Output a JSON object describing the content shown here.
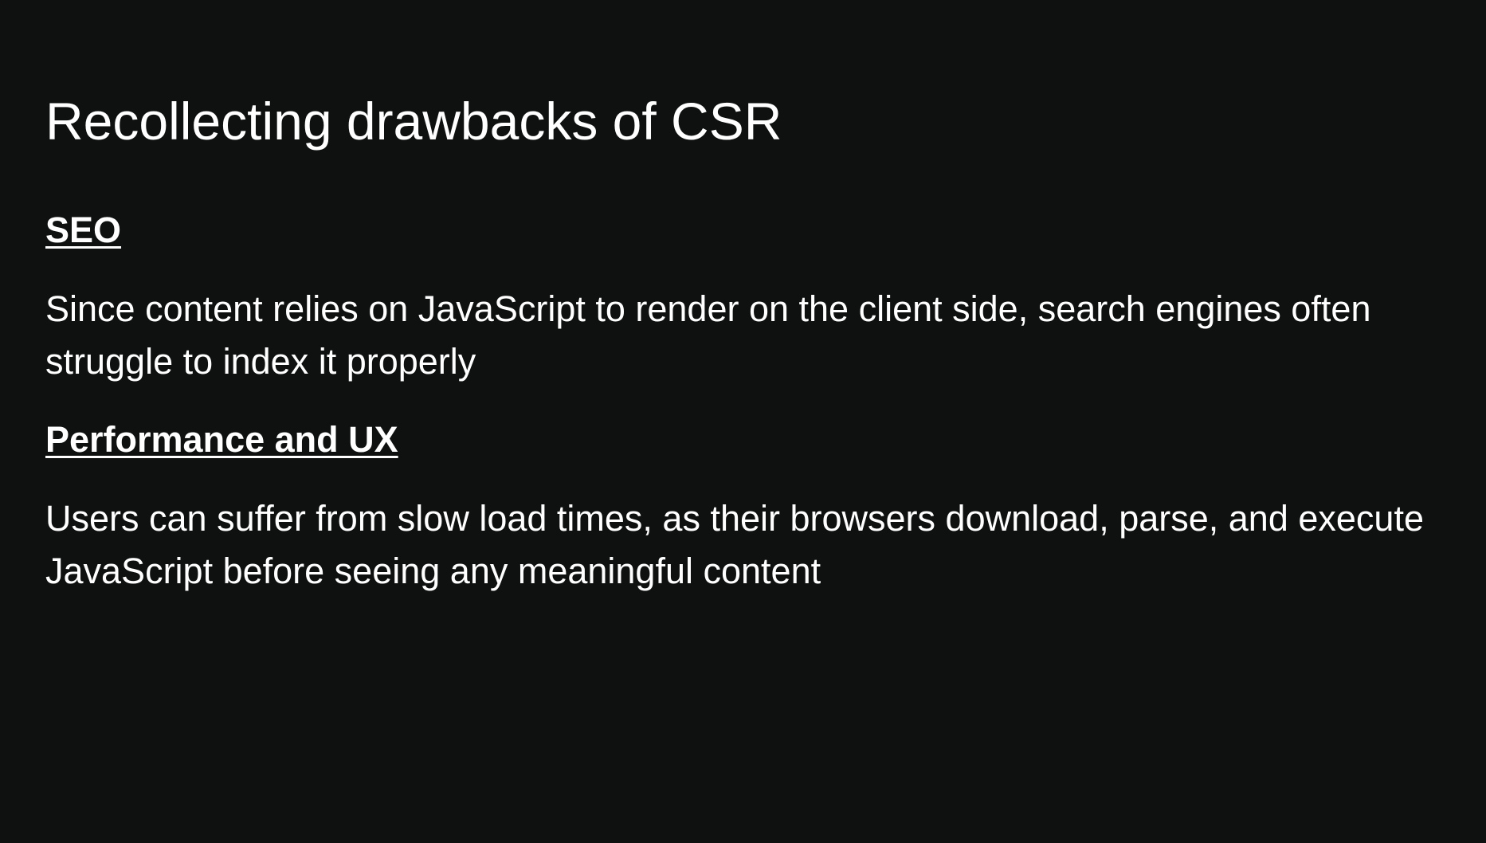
{
  "slide": {
    "title": "Recollecting drawbacks of CSR",
    "sections": [
      {
        "heading": "SEO",
        "body": "Since content relies on JavaScript to render on the client side, search engines often struggle to index it properly"
      },
      {
        "heading": "Performance and UX",
        "body": "Users can suffer from slow load times, as their browsers download, parse, and execute JavaScript before seeing any meaningful content"
      }
    ]
  },
  "colors": {
    "background": "#0f1111",
    "text": "#ffffff"
  }
}
